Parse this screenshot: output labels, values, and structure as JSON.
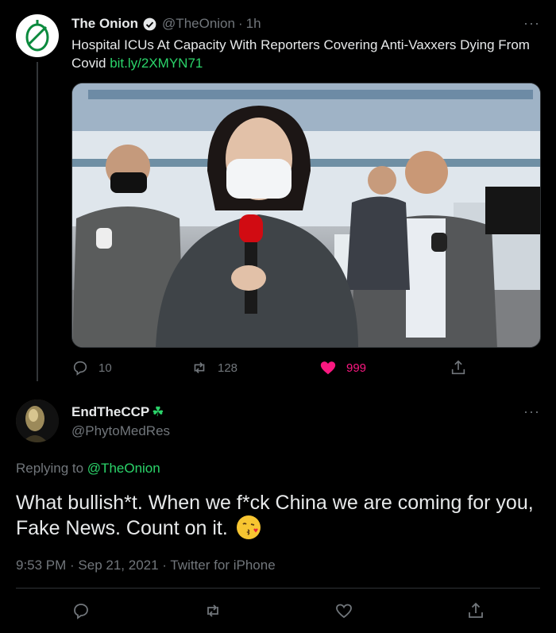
{
  "tweet": {
    "author_name": "The Onion",
    "author_handle": "@TheOnion",
    "separator": "·",
    "time_ago": "1h",
    "text": "Hospital ICUs At Capacity With Reporters Covering Anti-Vaxxers Dying From Covid",
    "link": "bit.ly/2XMYN71",
    "replies": "10",
    "retweets": "128",
    "likes": "999",
    "liked": true,
    "like_color": "#f91880"
  },
  "reply": {
    "author_name": "EndTheCCP",
    "author_badge": "☘",
    "author_handle": "@PhytoMedRes",
    "replying_label": "Replying to",
    "replying_to": "@TheOnion",
    "text": "What bullish*t. When we f*ck China we are coming for you, Fake News. Count on it.",
    "emoji": "kissing-face-emoji",
    "timestamp": "9:53 PM · Sep 21, 2021 · Twitter for iPhone"
  },
  "colors": {
    "background": "#000000",
    "link": "#2bd46a",
    "secondary_text": "#71767b"
  }
}
